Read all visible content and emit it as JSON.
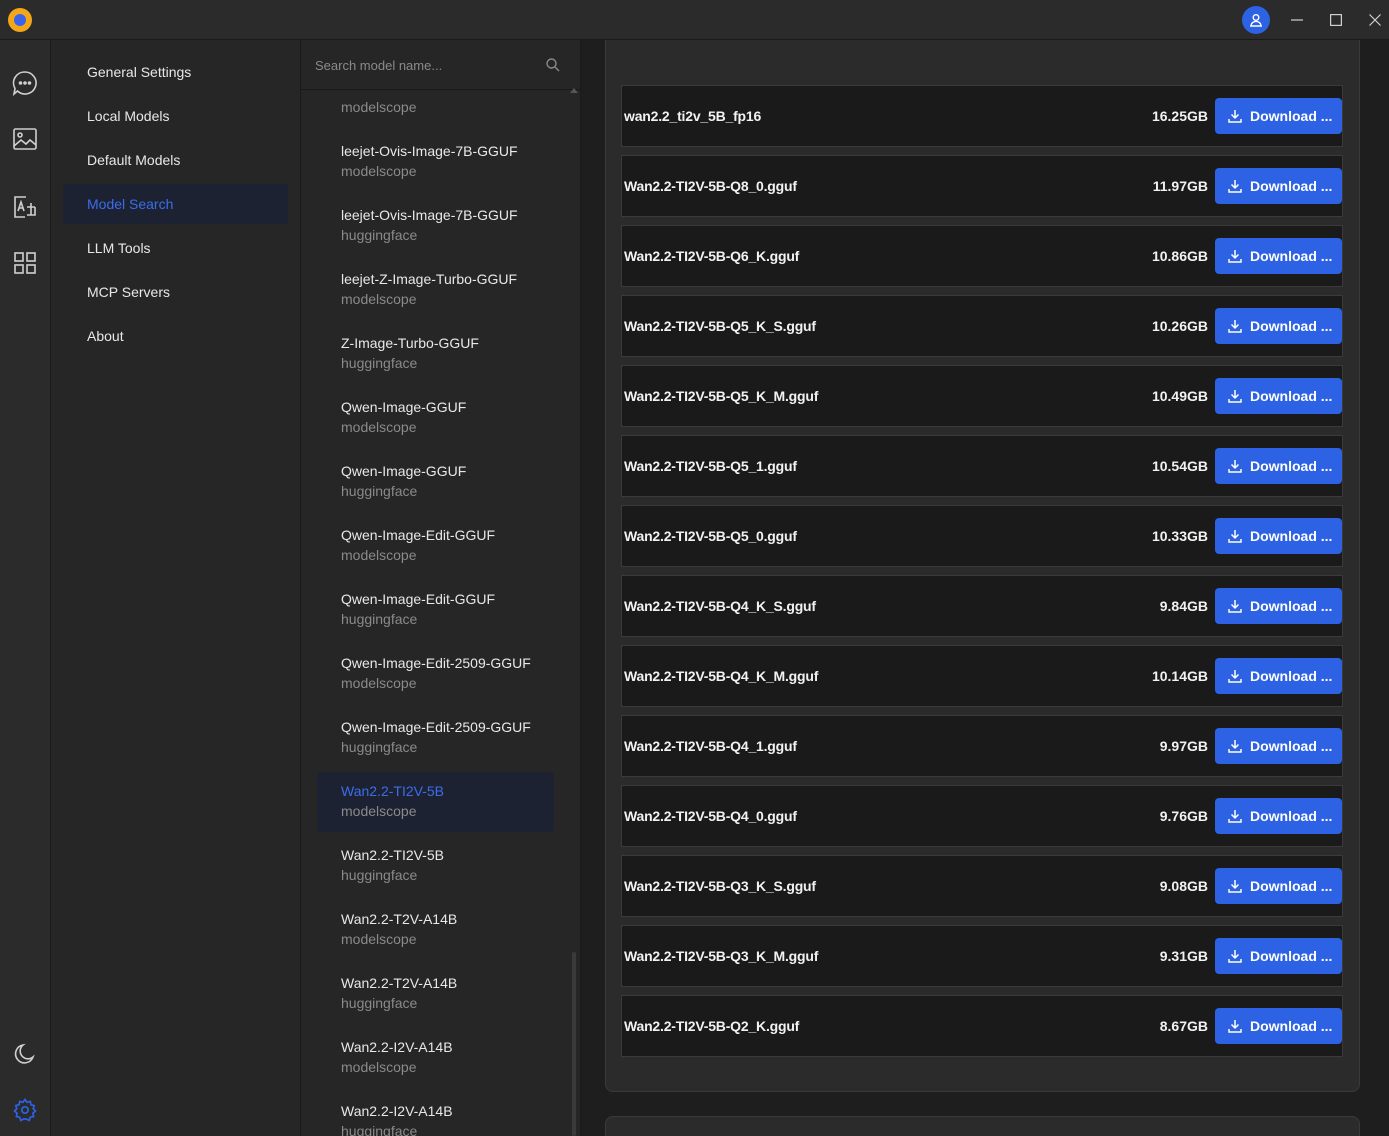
{
  "settings_nav": {
    "items": [
      {
        "label": "General Settings",
        "active": false
      },
      {
        "label": "Local Models",
        "active": false
      },
      {
        "label": "Default Models",
        "active": false
      },
      {
        "label": "Model Search",
        "active": true
      },
      {
        "label": "LLM Tools",
        "active": false
      },
      {
        "label": "MCP Servers",
        "active": false
      },
      {
        "label": "About",
        "active": false
      }
    ]
  },
  "search": {
    "placeholder": "Search model name..."
  },
  "models": [
    {
      "name": "",
      "source": "modelscope"
    },
    {
      "name": "leejet-Ovis-Image-7B-GGUF",
      "source": "modelscope"
    },
    {
      "name": "leejet-Ovis-Image-7B-GGUF",
      "source": "huggingface"
    },
    {
      "name": "leejet-Z-Image-Turbo-GGUF",
      "source": "modelscope"
    },
    {
      "name": "Z-Image-Turbo-GGUF",
      "source": "huggingface"
    },
    {
      "name": "Qwen-Image-GGUF",
      "source": "modelscope"
    },
    {
      "name": "Qwen-Image-GGUF",
      "source": "huggingface"
    },
    {
      "name": "Qwen-Image-Edit-GGUF",
      "source": "modelscope"
    },
    {
      "name": "Qwen-Image-Edit-GGUF",
      "source": "huggingface"
    },
    {
      "name": "Qwen-Image-Edit-2509-GGUF",
      "source": "modelscope"
    },
    {
      "name": "Qwen-Image-Edit-2509-GGUF",
      "source": "huggingface"
    },
    {
      "name": "Wan2.2-TI2V-5B",
      "source": "modelscope"
    },
    {
      "name": "Wan2.2-TI2V-5B",
      "source": "huggingface"
    },
    {
      "name": "Wan2.2-T2V-A14B",
      "source": "modelscope"
    },
    {
      "name": "Wan2.2-T2V-A14B",
      "source": "huggingface"
    },
    {
      "name": "Wan2.2-I2V-A14B",
      "source": "modelscope"
    },
    {
      "name": "Wan2.2-I2V-A14B",
      "source": "huggingface"
    }
  ],
  "selected_model_index": 11,
  "files": [
    {
      "name": "wan2.2_ti2v_5B_fp16",
      "size": "16.25GB",
      "action": "Download ..."
    },
    {
      "name": "Wan2.2-TI2V-5B-Q8_0.gguf",
      "size": "11.97GB",
      "action": "Download ..."
    },
    {
      "name": "Wan2.2-TI2V-5B-Q6_K.gguf",
      "size": "10.86GB",
      "action": "Download ..."
    },
    {
      "name": "Wan2.2-TI2V-5B-Q5_K_S.gguf",
      "size": "10.26GB",
      "action": "Download ..."
    },
    {
      "name": "Wan2.2-TI2V-5B-Q5_K_M.gguf",
      "size": "10.49GB",
      "action": "Download ..."
    },
    {
      "name": "Wan2.2-TI2V-5B-Q5_1.gguf",
      "size": "10.54GB",
      "action": "Download ..."
    },
    {
      "name": "Wan2.2-TI2V-5B-Q5_0.gguf",
      "size": "10.33GB",
      "action": "Download ..."
    },
    {
      "name": "Wan2.2-TI2V-5B-Q4_K_S.gguf",
      "size": "9.84GB",
      "action": "Download ..."
    },
    {
      "name": "Wan2.2-TI2V-5B-Q4_K_M.gguf",
      "size": "10.14GB",
      "action": "Download ..."
    },
    {
      "name": "Wan2.2-TI2V-5B-Q4_1.gguf",
      "size": "9.97GB",
      "action": "Download ..."
    },
    {
      "name": "Wan2.2-TI2V-5B-Q4_0.gguf",
      "size": "9.76GB",
      "action": "Download ..."
    },
    {
      "name": "Wan2.2-TI2V-5B-Q3_K_S.gguf",
      "size": "9.08GB",
      "action": "Download ..."
    },
    {
      "name": "Wan2.2-TI2V-5B-Q3_K_M.gguf",
      "size": "9.31GB",
      "action": "Download ..."
    },
    {
      "name": "Wan2.2-TI2V-5B-Q2_K.gguf",
      "size": "8.67GB",
      "action": "Download ..."
    }
  ],
  "rail_icons": [
    "chat-icon",
    "image-icon",
    "image-edit-icon",
    "apps-grid-icon",
    "moon-icon",
    "settings-gear-icon"
  ],
  "colors": {
    "accent": "#2d62e5",
    "active_text": "#3b6de8",
    "active_bg": "#1d2233",
    "logo_outer": "#f2a71b"
  }
}
